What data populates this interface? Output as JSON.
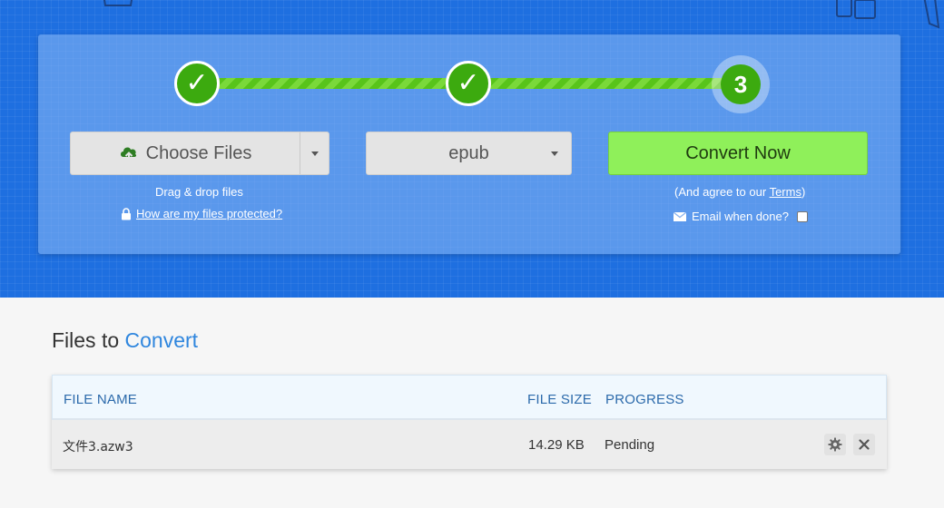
{
  "steps": {
    "step1_symbol": "✓",
    "step2_symbol": "✓",
    "step3_number": "3"
  },
  "upload": {
    "choose_label": "Choose Files",
    "drag_hint": "Drag & drop files",
    "protection_link": "How are my files protected?"
  },
  "format": {
    "selected": "epub"
  },
  "convert": {
    "button_label": "Convert Now",
    "terms_prefix": "(And agree to our ",
    "terms_link": "Terms",
    "terms_suffix": ")",
    "email_label": "Email when done?"
  },
  "files_section": {
    "title_part1": "Files to ",
    "title_part2": "Convert",
    "columns": {
      "name": "FILE NAME",
      "size": "FILE SIZE",
      "progress": "PROGRESS"
    },
    "rows": [
      {
        "name": "文件3.azw3",
        "size": "14.29 KB",
        "progress": "Pending"
      }
    ]
  },
  "colors": {
    "hero_blue": "#1e6fe0",
    "step_green": "#3caa0f",
    "convert_green": "#8ff05a",
    "accent_blue": "#2f86de"
  }
}
